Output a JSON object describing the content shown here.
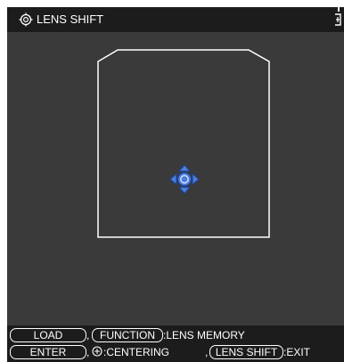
{
  "title": {
    "icon": "lens-shift-target-icon",
    "text": "LENS SHIFT"
  },
  "corner_icon": "menu-corner-icon",
  "shift_area": {
    "frame_shape": "projection-outline",
    "indicator_icon": "four-way-arrow-cursor-icon",
    "colors": {
      "outline": "#ffffff",
      "cursor_fill": "#4a7fd8",
      "cursor_dark": "#1f3f9a"
    }
  },
  "footer": {
    "row1": {
      "load_key": "LOAD",
      "sep1": ",",
      "function_key": "FUNCTION",
      "function_text": ":LENS MEMORY"
    },
    "row2": {
      "enter_key": "ENTER",
      "sep1": ",",
      "centering_icon": "centering-icon",
      "centering_text": ":CENTERING",
      "sep2": ",",
      "lens_shift_key": "LENS SHIFT",
      "exit_text": ":EXIT"
    }
  },
  "colors": {
    "panel_bg": "#3a3a3a",
    "bar_bg": "#1c1c1c",
    "text": "#ffffff"
  }
}
